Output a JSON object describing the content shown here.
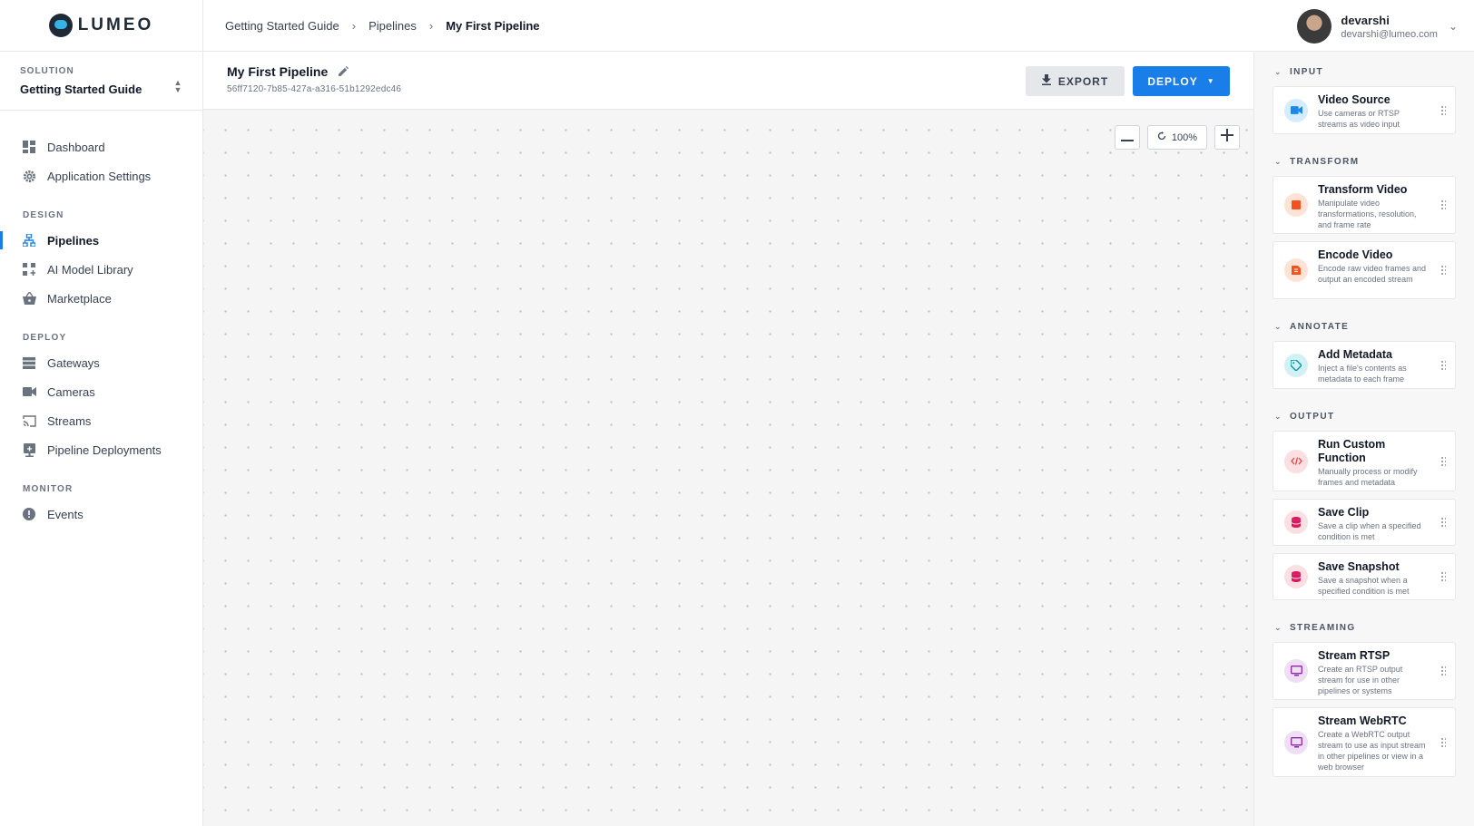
{
  "brand": {
    "name": "LUMEO"
  },
  "solution": {
    "label": "SOLUTION",
    "value": "Getting Started Guide"
  },
  "nav": {
    "top": [
      {
        "label": "Dashboard",
        "icon": "dashboard-icon"
      },
      {
        "label": "Application Settings",
        "icon": "gear-icon"
      }
    ],
    "design_label": "DESIGN",
    "design": [
      {
        "label": "Pipelines",
        "icon": "pipeline-icon",
        "active": true
      },
      {
        "label": "AI Model Library",
        "icon": "model-library-icon"
      },
      {
        "label": "Marketplace",
        "icon": "basket-icon"
      }
    ],
    "deploy_label": "DEPLOY",
    "deploy": [
      {
        "label": "Gateways",
        "icon": "server-icon"
      },
      {
        "label": "Cameras",
        "icon": "camera-icon"
      },
      {
        "label": "Streams",
        "icon": "cast-icon"
      },
      {
        "label": "Pipeline Deployments",
        "icon": "deployment-icon"
      }
    ],
    "monitor_label": "MONITOR",
    "monitor": [
      {
        "label": "Events",
        "icon": "alert-icon"
      }
    ]
  },
  "breadcrumb": [
    "Getting Started Guide",
    "Pipelines",
    "My First Pipeline"
  ],
  "user": {
    "name": "devarshi",
    "email": "devarshi@lumeo.com"
  },
  "pipeline": {
    "title": "My First Pipeline",
    "id": "56ff7120-7b85-427a-a316-51b1292edc46",
    "export_label": "EXPORT",
    "deploy_label": "DEPLOY"
  },
  "zoom": {
    "level": "100%"
  },
  "palette": {
    "input": {
      "label": "INPUT",
      "items": [
        {
          "title": "Video Source",
          "desc": "Use cameras or RTSP streams as video input",
          "color": "#1e88e5",
          "bg": "#d6ebfb",
          "icon": "video-camera-icon"
        }
      ]
    },
    "transform": {
      "label": "TRANSFORM",
      "items": [
        {
          "title": "Transform Video",
          "desc": "Manipulate video transformations, resolution, and frame rate",
          "color": "#f4511e",
          "bg": "#fde2d6",
          "icon": "crop-icon"
        },
        {
          "title": "Encode Video",
          "desc": "Encode raw video frames and output an encoded stream",
          "color": "#f4511e",
          "bg": "#fde2d6",
          "icon": "encode-icon"
        }
      ]
    },
    "annotate": {
      "label": "ANNOTATE",
      "items": [
        {
          "title": "Add Metadata",
          "desc": "Inject a file's contents as metadata to each frame",
          "color": "#0097a7",
          "bg": "#d3f1f4",
          "icon": "tag-icon"
        }
      ]
    },
    "output": {
      "label": "OUTPUT",
      "items": [
        {
          "title": "Run Custom Function",
          "desc": "Manually process or modify frames and metadata",
          "color": "#e53935",
          "bg": "#fcdfe3",
          "icon": "code-icon"
        },
        {
          "title": "Save Clip",
          "desc": "Save a clip when a specified condition is met",
          "color": "#d81b60",
          "bg": "#fcdfe3",
          "icon": "database-icon"
        },
        {
          "title": "Save Snapshot",
          "desc": "Save a snapshot when a specified condition is met",
          "color": "#d81b60",
          "bg": "#fcdfe3",
          "icon": "database-icon"
        }
      ]
    },
    "streaming": {
      "label": "STREAMING",
      "items": [
        {
          "title": "Stream RTSP",
          "desc": "Create an RTSP output stream for use in other pipelines or systems",
          "color": "#8e24aa",
          "bg": "#eedff5",
          "icon": "monitor-icon"
        },
        {
          "title": "Stream WebRTC",
          "desc": "Create a WebRTC output stream to use as input stream in other pipelines or view in a web browser",
          "color": "#8e24aa",
          "bg": "#eedff5",
          "icon": "monitor-icon"
        }
      ]
    }
  }
}
